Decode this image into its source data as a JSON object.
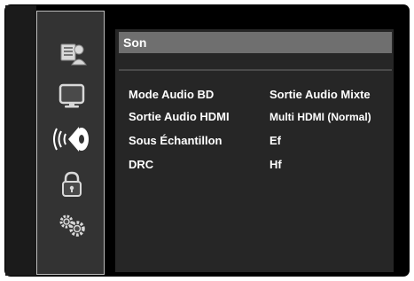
{
  "sidebar": {
    "items": [
      {
        "icon": "disc-info-icon",
        "selected": false
      },
      {
        "icon": "tv-display-icon",
        "selected": false
      },
      {
        "icon": "speaker-audio-icon",
        "selected": true
      },
      {
        "icon": "lock-icon",
        "selected": false
      },
      {
        "icon": "gears-icon",
        "selected": false
      }
    ]
  },
  "panel": {
    "title": "Son",
    "rows": [
      {
        "label": "Mode Audio BD",
        "value": "Sortie Audio Mixte"
      },
      {
        "label": "Sortie Audio HDMI",
        "value": "Multi HDMI (Normal)"
      },
      {
        "label": "Sous Échantillon",
        "value": "Ef"
      },
      {
        "label": "DRC",
        "value": "Hf"
      }
    ]
  },
  "colors": {
    "background": "#000000",
    "sidebar": "#333333",
    "panel": "#262626",
    "title_bar": "#6f6f6f",
    "text": "#ffffff"
  }
}
